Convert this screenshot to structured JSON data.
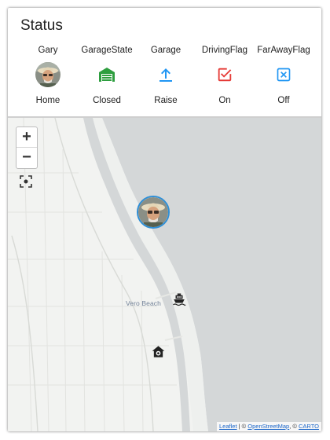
{
  "card": {
    "title": "Status",
    "entities": [
      {
        "name": "Gary",
        "state": "Home",
        "icon": "person-avatar"
      },
      {
        "name": "GarageState",
        "state": "Closed",
        "icon": "garage-closed-icon",
        "color": "#2e9e3f"
      },
      {
        "name": "Garage",
        "state": "Raise",
        "icon": "arrow-up-icon",
        "color": "#2196f3"
      },
      {
        "name": "DrivingFlag",
        "state": "On",
        "icon": "checkbox-checked-icon",
        "color": "#e53935"
      },
      {
        "name": "FarAwayFlag",
        "state": "Off",
        "icon": "checkbox-x-icon",
        "color": "#2196f3"
      }
    ]
  },
  "map": {
    "zoom_in": "+",
    "zoom_out": "−",
    "place_label": "Vero Beach",
    "attribution": {
      "leaflet": "Leaflet",
      "sep1": " | © ",
      "osm": "OpenStreetMap",
      "sep2": ", © ",
      "carto": "CARTO"
    }
  }
}
